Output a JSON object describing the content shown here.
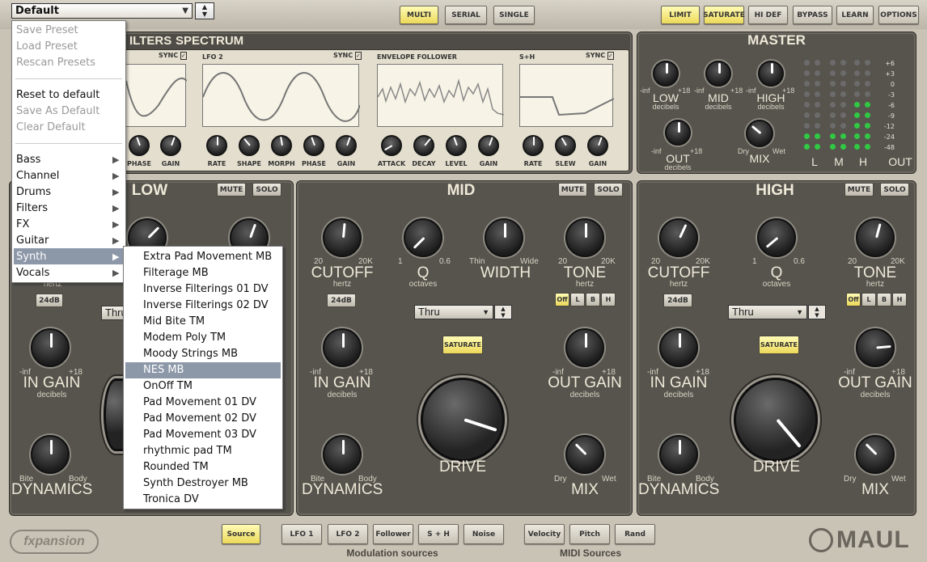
{
  "preset": {
    "name": "Default"
  },
  "header": {
    "routing": [
      "MULTI",
      "SERIAL",
      "SINGLE"
    ],
    "right": [
      "LIMIT",
      "SATURATE",
      "HI DEF",
      "BYPASS",
      "LEARN",
      "OPTIONS"
    ]
  },
  "modulation": {
    "tabs": [
      "ILTERS",
      "SPECTRUM"
    ],
    "lfo2": "LFO 2",
    "sync": "SYNC",
    "env": "ENVELOPE FOLLOWER",
    "sh": "S+H",
    "knobs1": [
      "PHASE",
      "GAIN"
    ],
    "knobs2": [
      "RATE",
      "SHAPE",
      "MORPH",
      "PHASE",
      "GAIN"
    ],
    "knobs3": [
      "ATTACK",
      "DECAY",
      "LEVEL",
      "GAIN"
    ],
    "knobs4": [
      "RATE",
      "SLEW",
      "GAIN"
    ]
  },
  "master": {
    "title": "MASTER",
    "low": "LOW",
    "mid": "MID",
    "high": "HIGH",
    "out": "OUT",
    "mix": "MIX",
    "decibels": "decibels",
    "neginf": "-inf",
    "p18": "+18",
    "dry": "Dry",
    "wet": "Wet",
    "scale": [
      "+6",
      "+3",
      "0",
      "-3",
      "-6",
      "-9",
      "-12",
      "-24",
      "-48"
    ],
    "meter_labels": [
      "L",
      "M",
      "H",
      "OUT"
    ]
  },
  "bands": {
    "low": "LOW",
    "mid": "MID",
    "high": "HIGH",
    "mute": "MUTE",
    "solo": "SOLO",
    "cutoff": "CUTOFF",
    "q": "Q",
    "width": "WIDTH",
    "tone": "TONE",
    "hertz": "hertz",
    "octaves": "octaves",
    "in_gain": "IN GAIN",
    "out_gain": "OUT GAIN",
    "drive": "DRIVE",
    "dynamics": "DYNAMICS",
    "mix": "MIX",
    "decibels": "decibels",
    "db24": "24dB",
    "thru": "Thru",
    "saturate": "SATURATE",
    "r20": "20",
    "r20k": "20K",
    "r1": "1",
    "r06": "0.6",
    "thin": "Thin",
    "wide": "Wide",
    "bite": "Bite",
    "body": "Body",
    "dry": "Dry",
    "wet": "Wet",
    "neginf": "-inf",
    "p18": "+18",
    "tone_btns": [
      "Off",
      "L",
      "B",
      "H"
    ]
  },
  "footer": {
    "sources": [
      "Source",
      "LFO 1",
      "LFO 2",
      "Follower",
      "S + H",
      "Noise"
    ],
    "midi": [
      "Velocity",
      "Pitch",
      "Rand"
    ],
    "mod_label": "Modulation sources",
    "midi_label": "MIDI Sources",
    "brand": "fxpansion",
    "product": "MAUL"
  },
  "menu": {
    "items": [
      "Save Preset",
      "Load Preset",
      "Rescan Presets",
      "Reset to default",
      "Save As Default",
      "Clear Default",
      "Bass",
      "Channel",
      "Drums",
      "Filters",
      "FX",
      "Guitar",
      "Synth",
      "Vocals"
    ],
    "submenu": [
      "Extra Pad Movement MB",
      "Filterage MB",
      "Inverse Filterings 01 DV",
      "Inverse Filterings 02 DV",
      "Mid Bite TM",
      "Modem Poly TM",
      "Moody Strings MB",
      "NES MB",
      "OnOff TM",
      "Pad Movement 01 DV",
      "Pad Movement 02 DV",
      "Pad Movement 03 DV",
      "rhythmic pad TM",
      "Rounded TM",
      "Synth Destroyer MB",
      "Tronica DV"
    ]
  }
}
